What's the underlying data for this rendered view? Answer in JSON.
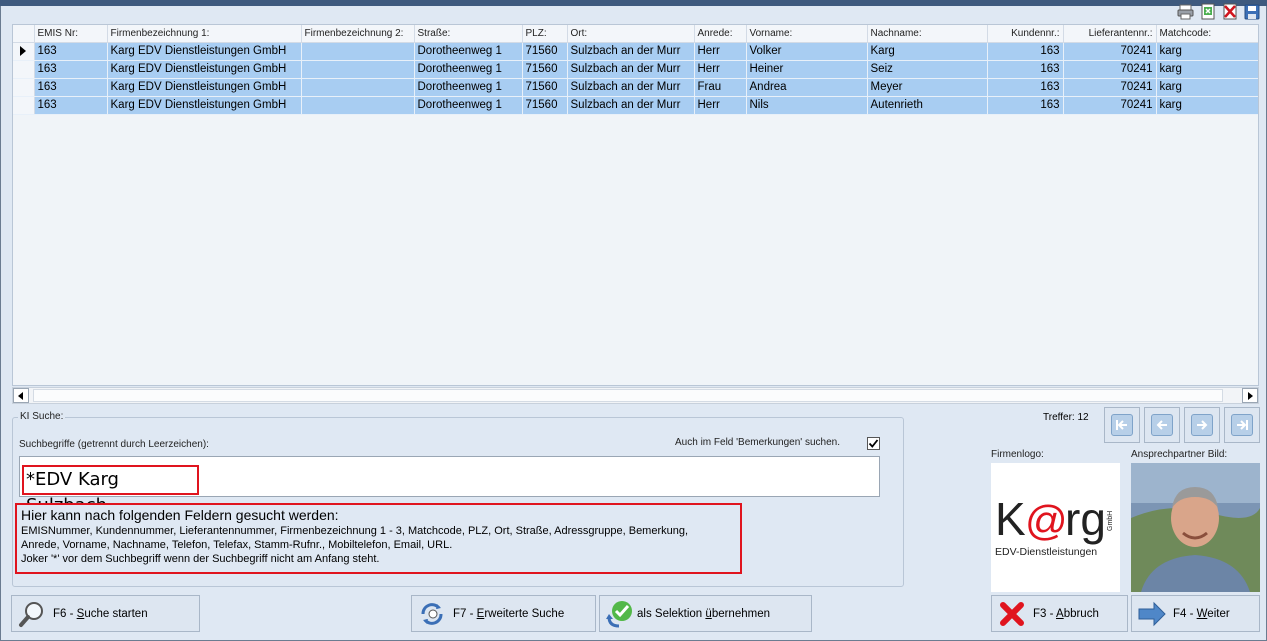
{
  "toolbar": {
    "icons": [
      "print-icon",
      "export-icon",
      "delete-icon",
      "save-icon"
    ]
  },
  "grid": {
    "columns": [
      "EMIS Nr:",
      "Firmenbezeichnung 1:",
      "Firmenbezeichnung 2:",
      "Straße:",
      "PLZ:",
      "Ort:",
      "Anrede:",
      "Vorname:",
      "Nachname:",
      "Kundennr.:",
      "Lieferantennr.:",
      "Matchcode:"
    ],
    "rows": [
      [
        "163",
        "Karg EDV Dienstleistungen GmbH",
        "",
        "Dorotheenweg 1",
        "71560",
        "Sulzbach an der Murr",
        "Herr",
        "Volker",
        "Karg",
        "163",
        "70241",
        "karg"
      ],
      [
        "163",
        "Karg EDV Dienstleistungen GmbH",
        "",
        "Dorotheenweg 1",
        "71560",
        "Sulzbach an der Murr",
        "Herr",
        "Heiner",
        "Seiz",
        "163",
        "70241",
        "karg"
      ],
      [
        "163",
        "Karg EDV Dienstleistungen GmbH",
        "",
        "Dorotheenweg 1",
        "71560",
        "Sulzbach an der Murr",
        "Frau",
        "Andrea",
        "Meyer",
        "163",
        "70241",
        "karg"
      ],
      [
        "163",
        "Karg EDV Dienstleistungen GmbH",
        "",
        "Dorotheenweg 1",
        "71560",
        "Sulzbach an der Murr",
        "Herr",
        "Nils",
        "Autenrieth",
        "163",
        "70241",
        "karg"
      ]
    ]
  },
  "search": {
    "group_label": "KI Suche:",
    "terms_label": "Suchbegriffe (getrennt durch Leerzeichen):",
    "remarks_label": "Auch im Feld 'Bemerkungen' suchen.",
    "remarks_checked": true,
    "value": "*EDV Karg Sulzbach",
    "info_title": "Hier kann nach folgenden Feldern gesucht werden:",
    "info_line1": "EMISNummer, Kundennummer, Lieferantennummer, Firmenbezeichnung 1 - 3, Matchcode, PLZ, Ort, Straße, Adressgruppe, Bemerkung,",
    "info_line2": "Anrede, Vorname, Nachname, Telefon, Telefax, Stamm-Rufnr., Mobiltelefon, Email, URL.",
    "info_line3": "Joker '*' vor dem Suchbegriff wenn der Suchbegriff nicht am Anfang steht."
  },
  "right": {
    "treffer": "Treffer: 12",
    "firmenlogo_label": "Firmenlogo:",
    "photo_label": "Ansprechpartner Bild:",
    "logo_text": "K@rg",
    "logo_gmbh": "GmbH",
    "logo_sub": "EDV-Dienstleistungen"
  },
  "buttons": {
    "f6_prefix": "F6 - ",
    "f6_key": "S",
    "f6_rest": "uche starten",
    "f7_prefix": "F7 - ",
    "f7_key": "E",
    "f7_rest": "rweiterte Suche",
    "sel_prefix": "als Selektion ",
    "sel_key": "ü",
    "sel_rest": "bernehmen",
    "f3_prefix": "F3 - ",
    "f3_key": "A",
    "f3_rest": "bbruch",
    "f4_prefix": "F4 - ",
    "f4_key": "W",
    "f4_rest": "eiter"
  },
  "colors": {
    "accent": "#a8cdf2",
    "highlight_red": "#e0141e",
    "background": "#dfe8f3"
  }
}
